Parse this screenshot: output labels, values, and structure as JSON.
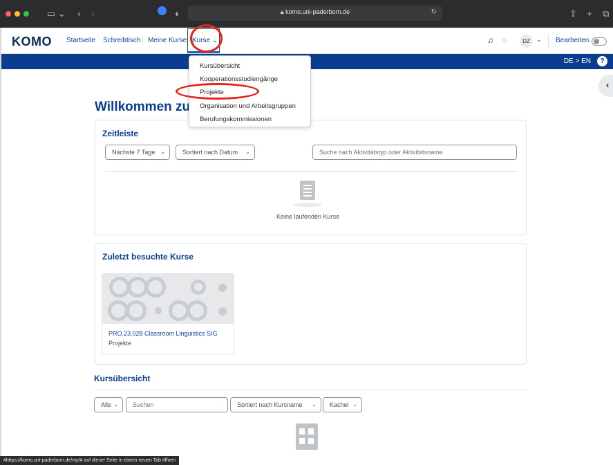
{
  "browser": {
    "url": "komo.uni-paderborn.de",
    "status_text": "#https://komo.uni-paderborn.de/my/# auf dieser Seite in einem neuen Tab öffnen"
  },
  "navbar": {
    "logo": "KOMO",
    "links": [
      "Startseite",
      "Schreibtisch",
      "Meine Kurse",
      "Kurse ⌄"
    ],
    "avatar": "DZ",
    "edit_label": "Bearbeiten"
  },
  "bluebar": {
    "lang": "DE > EN",
    "help": "?"
  },
  "welcome": "Willkommen zurück, Dorothee! 👋",
  "timeline": {
    "title": "Zeitleiste",
    "filter_days": "Nächste 7 Tage",
    "sort": "Sortiert nach Datum",
    "search_placeholder": "Suche nach Aktivitätstyp oder Aktivitätsname",
    "empty": "Keine laufenden Kurse"
  },
  "recent": {
    "title": "Zuletzt besuchte Kurse",
    "course_name": "PRO.23.028 Classroom Linguistics SIG",
    "course_category": "Projekte"
  },
  "overview": {
    "title": "Kursübersicht",
    "filter": "Alle",
    "search_placeholder": "Suchen",
    "sort": "Sortiert nach Kursname",
    "view": "Kachel"
  },
  "dropdown": {
    "items": [
      "Kursübersicht",
      "Kooperationsstudiengänge",
      "Projekte",
      "Organisation und Arbeitsgruppen",
      "Berufungskommissionen"
    ]
  },
  "colors": {
    "accent": "#0a3d8f",
    "highlight": "#e5231b"
  }
}
